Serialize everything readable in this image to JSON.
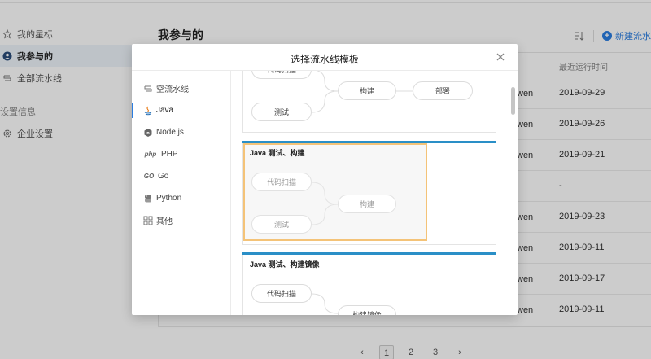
{
  "sidebar": {
    "items": [
      {
        "label": "我的星标",
        "icon": "star-icon"
      },
      {
        "label": "我参与的",
        "icon": "user-icon",
        "active": true
      },
      {
        "label": "全部流水线",
        "icon": "pipeline-icon"
      }
    ],
    "section_title": "设置信息",
    "settings_items": [
      {
        "label": "企业设置",
        "icon": "gear-icon"
      }
    ]
  },
  "content": {
    "title": "我参与的",
    "new_button_label": "新建流水",
    "table": {
      "header_time": "最近运行时间",
      "rows": [
        {
          "user": "wen",
          "time": "2019-09-29"
        },
        {
          "user": "wen",
          "time": "2019-09-26"
        },
        {
          "user": "wen",
          "time": "2019-09-21"
        },
        {
          "user": "",
          "time": "-"
        },
        {
          "user": "wen",
          "time": "2019-09-23"
        },
        {
          "user": "wen",
          "time": "2019-09-11"
        },
        {
          "user": "wen",
          "time": "2019-09-17"
        },
        {
          "user": "wen",
          "time": "2019-09-11"
        }
      ]
    },
    "pagination": {
      "pages": [
        "1",
        "2",
        "3"
      ],
      "current": "1",
      "prev": "‹",
      "next": "›"
    }
  },
  "modal": {
    "title": "选择流水线模板",
    "categories": [
      {
        "label": "空流水线",
        "icon": "empty-pipeline-icon"
      },
      {
        "label": "Java",
        "icon": "java-icon",
        "active": true
      },
      {
        "label": "Node.js",
        "icon": "nodejs-icon"
      },
      {
        "label": "PHP",
        "icon": "php-icon",
        "icon_text": "php"
      },
      {
        "label": "Go",
        "icon": "go-icon",
        "icon_text": "GO"
      },
      {
        "label": "Python",
        "icon": "python-icon"
      },
      {
        "label": "其他",
        "icon": "grid-icon"
      }
    ],
    "templates": [
      {
        "title": "",
        "nodes": {
          "scan": "代码扫描",
          "test": "测试",
          "build": "构建",
          "deploy": "部署"
        }
      },
      {
        "title": "Java 测试、构建",
        "nodes": {
          "scan": "代码扫描",
          "test": "测试",
          "build": "构建"
        }
      },
      {
        "title": "Java 测试、构建镜像",
        "nodes": {
          "scan": "代码扫描",
          "build_image": "构建镜像"
        }
      }
    ]
  },
  "colors": {
    "accent": "#2a7de1",
    "card_bar": "#2a8fc7",
    "ghost_border": "#f4c378"
  }
}
